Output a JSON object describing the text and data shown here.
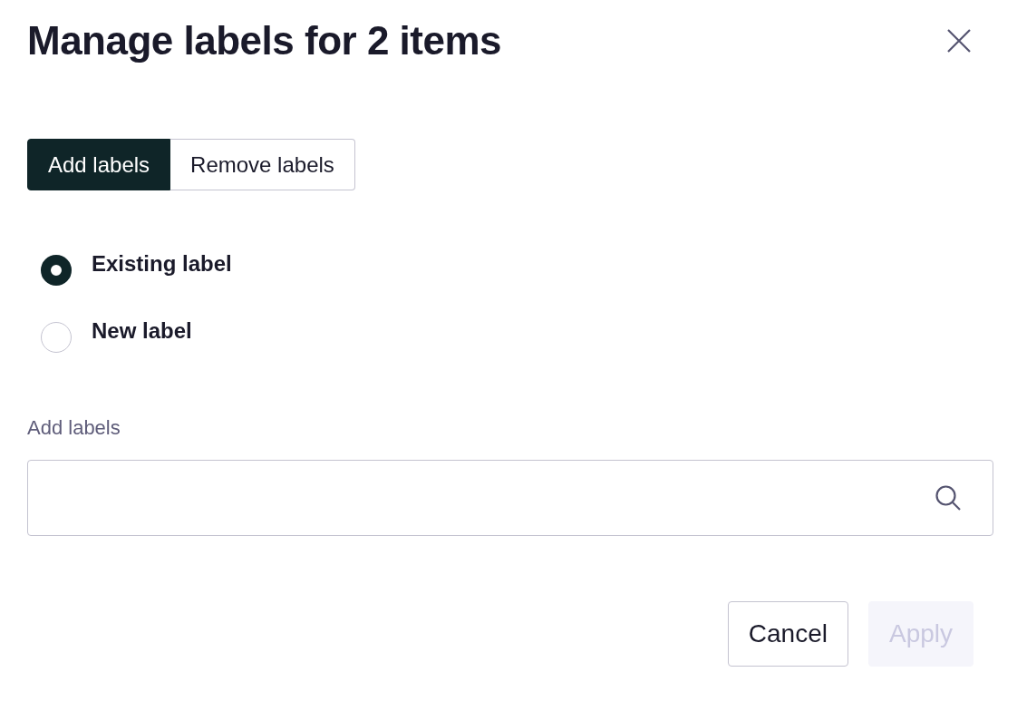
{
  "dialog": {
    "title": "Manage labels for 2 items"
  },
  "tabs": [
    {
      "label": "Add labels",
      "selected": true
    },
    {
      "label": "Remove labels",
      "selected": false
    }
  ],
  "options": [
    {
      "label": "Existing label",
      "selected": true
    },
    {
      "label": "New label",
      "selected": false
    }
  ],
  "field": {
    "label": "Add labels"
  },
  "buttons": [
    {
      "label": "Cancel",
      "disabled": false
    },
    {
      "label": "Apply",
      "disabled": true
    }
  ]
}
